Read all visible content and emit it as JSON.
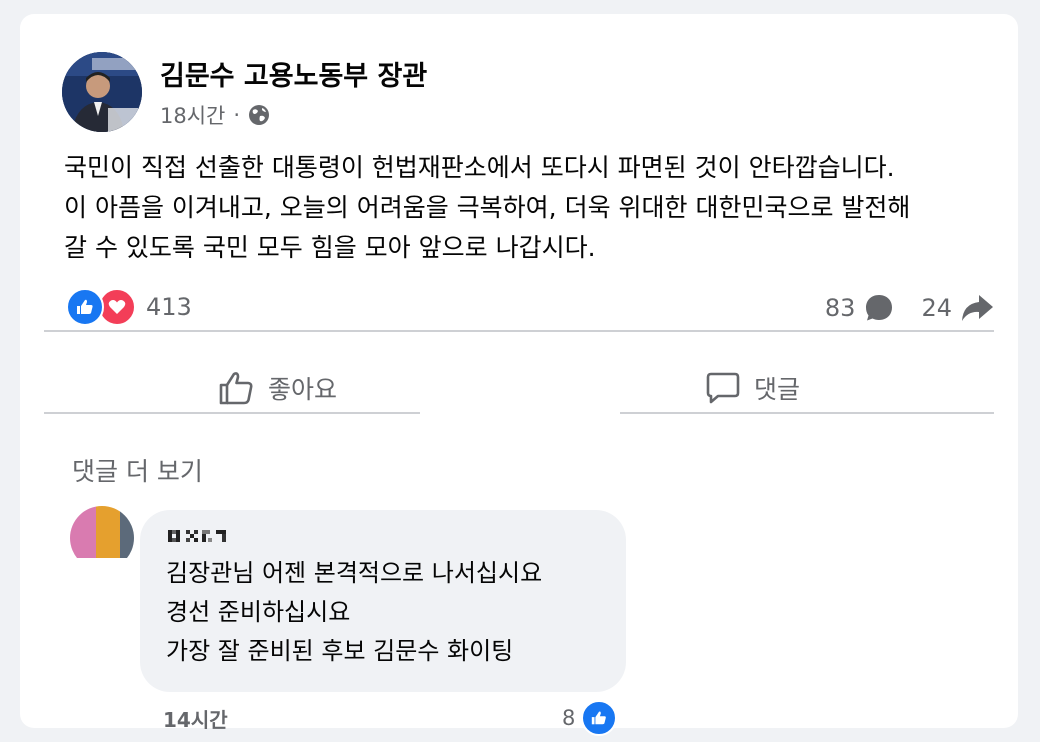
{
  "post": {
    "author": "김문수 고용노동부 장관",
    "time": "18시간",
    "separator": "·",
    "privacy_icon": "globe-icon",
    "text_lines": [
      "국민이 직접 선출한 대통령이 헌법재판소에서 또다시 파면된 것이 안타깝습니다.",
      "이 아픔을 이겨내고, 오늘의 어려움을 극복하여, 더욱 위대한 대한민국으로 발전해",
      "갈 수 있도록 국민 모두 힘을 모아 앞으로 나갑시다."
    ],
    "reactions": {
      "icons": [
        "like-icon",
        "love-icon"
      ],
      "count": "413"
    },
    "comments_count": "83",
    "shares_count": "24"
  },
  "actions": {
    "like_label": "좋아요",
    "comment_label": "댓글"
  },
  "comments": {
    "more_label": "댓글 더 보기",
    "items": [
      {
        "lines": [
          "김장관님 어젠 본격적으로 나서십시요",
          "경선 준비하십시요",
          "가장 잘 준비된 후보 김문수 화이팅"
        ],
        "time": "14시간",
        "likes": "8"
      }
    ]
  },
  "colors": {
    "accent": "#1877f2",
    "love": "#f33e58",
    "muted_text": "#65676b",
    "text": "#050505",
    "background": "#f0f2f5"
  }
}
